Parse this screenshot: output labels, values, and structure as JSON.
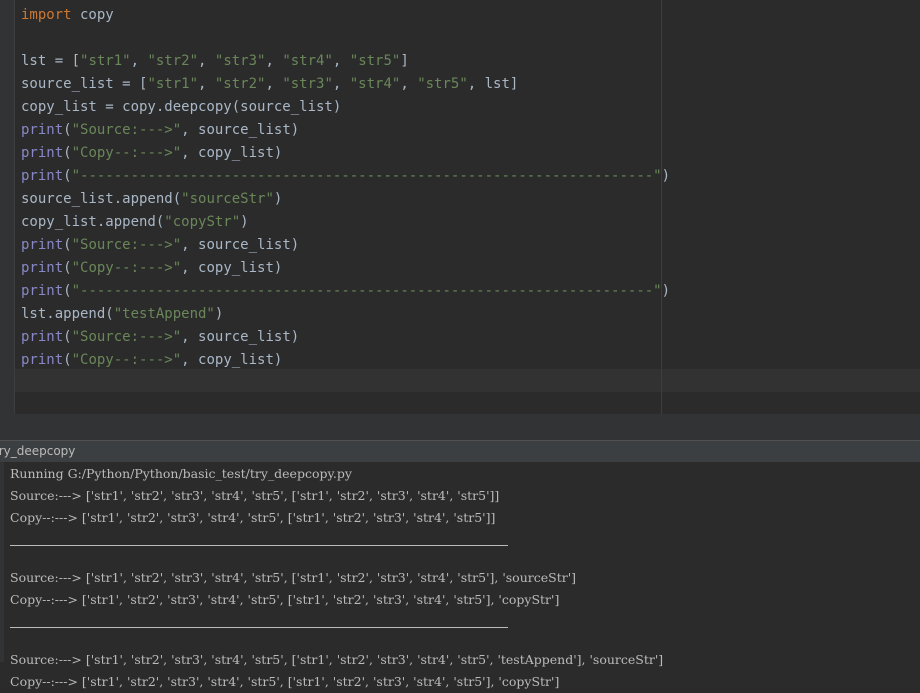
{
  "editor": {
    "code_lines": [
      "import copy",
      "",
      "lst = [\"str1\", \"str2\", \"str3\", \"str4\", \"str5\"]",
      "source_list = [\"str1\", \"str2\", \"str3\", \"str4\", \"str5\", lst]",
      "copy_list = copy.deepcopy(source_list)",
      "print(\"Source:--->\", source_list)",
      "print(\"Copy--:--->\", copy_list)",
      "print(\"--------------------------------------------------------------------\")",
      "source_list.append(\"sourceStr\")",
      "copy_list.append(\"copyStr\")",
      "print(\"Source:--->\", source_list)",
      "print(\"Copy--:--->\", copy_list)",
      "print(\"--------------------------------------------------------------------\")",
      "lst.append(\"testAppend\")",
      "print(\"Source:--->\", source_list)",
      "print(\"Copy--:--->\", copy_list)"
    ]
  },
  "run_panel": {
    "title": "try_deepcopy",
    "output_lines": [
      "Running G:/Python/Python/basic_test/try_deepcopy.py",
      "Source:---> ['str1', 'str2', 'str3', 'str4', 'str5', ['str1', 'str2', 'str3', 'str4', 'str5']]",
      "Copy--:---> ['str1', 'str2', 'str3', 'str4', 'str5', ['str1', 'str2', 'str3', 'str4', 'str5']]",
      "---",
      "Source:---> ['str1', 'str2', 'str3', 'str4', 'str5', ['str1', 'str2', 'str3', 'str4', 'str5'], 'sourceStr']",
      "Copy--:---> ['str1', 'str2', 'str3', 'str4', 'str5', ['str1', 'str2', 'str3', 'str4', 'str5'], 'copyStr']",
      "---",
      "Source:---> ['str1', 'str2', 'str3', 'str4', 'str5', ['str1', 'str2', 'str3', 'str4', 'str5', 'testAppend'], 'sourceStr']",
      "Copy--:---> ['str1', 'str2', 'str3', 'str4', 'str5', ['str1', 'str2', 'str3', 'str4', 'str5'], 'copyStr']"
    ]
  }
}
